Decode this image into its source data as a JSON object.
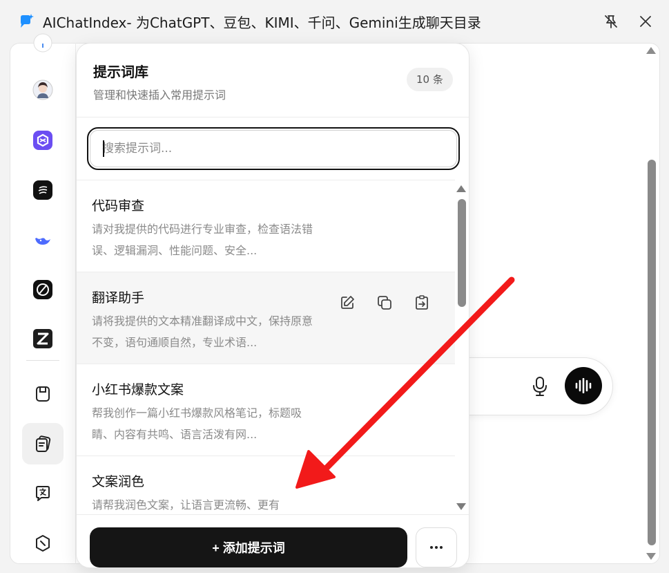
{
  "window": {
    "title": "AIChatIndex- 为ChatGPT、豆包、KIMI、千问、Gemini生成聊天目录",
    "pin_icon": "pin-off-icon",
    "close_icon": "close-icon"
  },
  "sidebar": {
    "items": [
      {
        "name": "sidebar-item-top-partial",
        "icon": "assistant-icon"
      },
      {
        "name": "sidebar-item-avatar",
        "icon": "avatar-icon"
      },
      {
        "name": "sidebar-item-purple",
        "icon": "purple-hex-icon"
      },
      {
        "name": "sidebar-item-kimi",
        "icon": "moon-icon"
      },
      {
        "name": "sidebar-item-deepseek",
        "icon": "whale-icon"
      },
      {
        "name": "sidebar-item-grok",
        "icon": "slash-circle-icon"
      },
      {
        "name": "sidebar-item-z",
        "icon": "z-logo-icon"
      },
      {
        "name": "sidebar-item-save",
        "icon": "save-icon"
      },
      {
        "name": "sidebar-item-prompts",
        "icon": "prompt-cards-icon",
        "active": true
      },
      {
        "name": "sidebar-item-translate",
        "icon": "translate-icon"
      },
      {
        "name": "sidebar-item-bottom",
        "icon": "circle-slash-icon"
      }
    ]
  },
  "panel": {
    "title": "提示词库",
    "subtitle": "管理和快速插入常用提示词",
    "count": "10 条",
    "search": {
      "placeholder": "搜索提示词...",
      "value": ""
    },
    "items": [
      {
        "title": "代码审查",
        "desc": "请对我提供的代码进行专业审查，检查语法错误、逻辑漏洞、性能问题、安全..."
      },
      {
        "title": "翻译助手",
        "desc": "请将我提供的文本精准翻译成中文，保持原意不变，语句通顺自然，专业术语...",
        "actions": [
          "edit-icon",
          "copy-icon",
          "insert-icon"
        ]
      },
      {
        "title": "小红书爆款文案",
        "desc": "帮我创作一篇小红书爆款风格笔记，标题吸睛、内容有共鸣、语言活泼有网..."
      },
      {
        "title": "文案润色",
        "desc": "请帮我润色文案，让语言更流畅、更有"
      }
    ],
    "add_button": "+ 添加提示词",
    "more_icon": "more-horizontal-icon"
  },
  "chat_bar": {
    "mic_icon": "microphone-icon",
    "voice_icon": "voice-wave-icon"
  },
  "colors": {
    "accent": "#111111",
    "annotation_arrow": "#f21a1a",
    "badge_bg": "#f0f0f0"
  }
}
